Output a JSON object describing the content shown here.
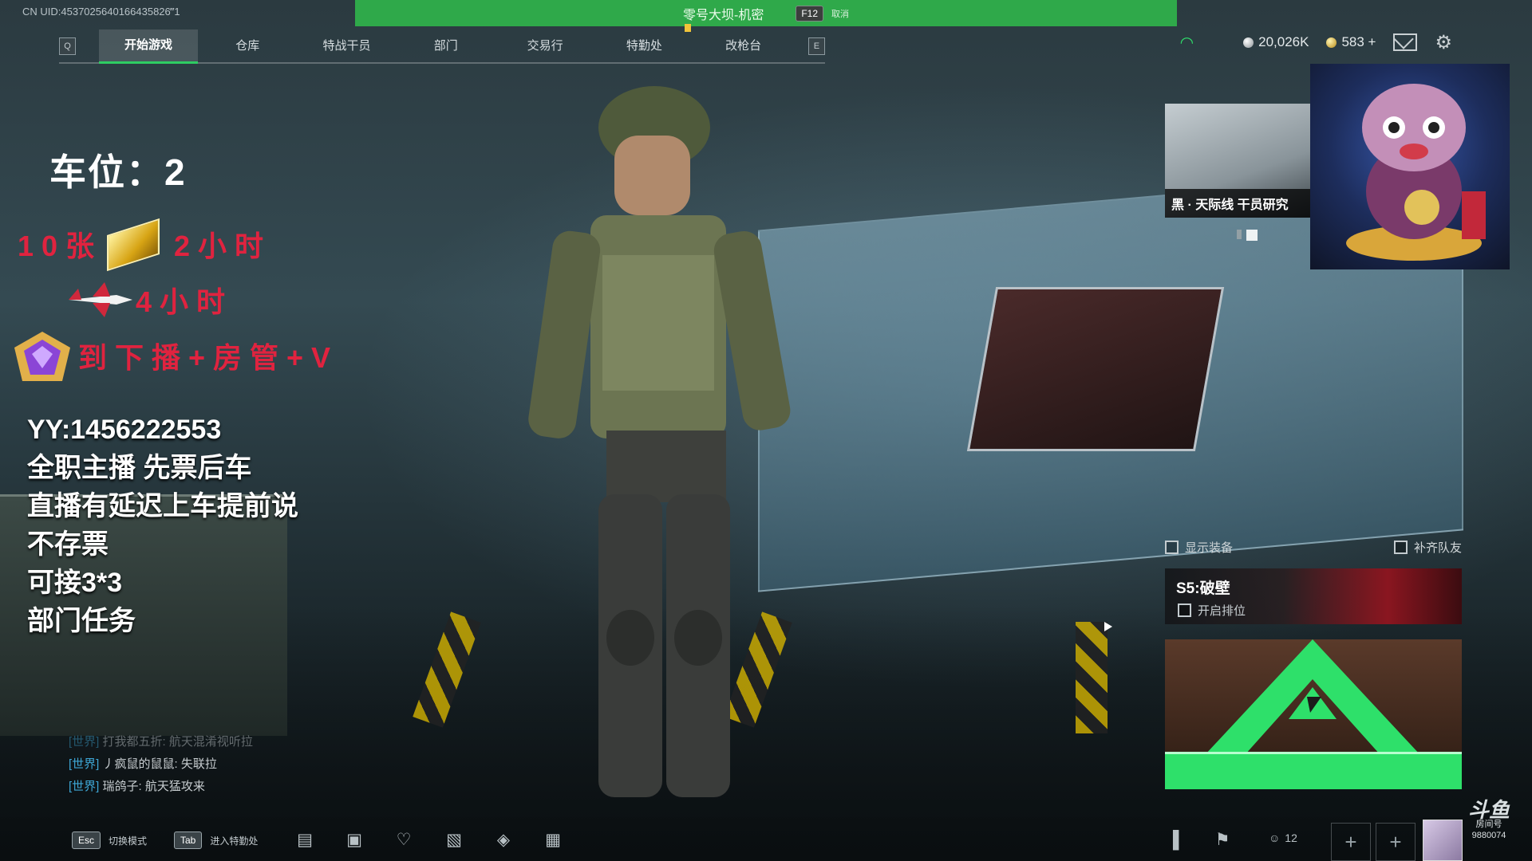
{
  "uid": "CN UID:4537025640166435826‴1",
  "banner": {
    "title": "零号大坝-机密",
    "key": "F12",
    "cancel": "取消"
  },
  "nav": {
    "left_key": "Q",
    "right_key": "E",
    "tabs": [
      "开始游戏",
      "仓库",
      "特战干员",
      "部门",
      "交易行",
      "特勤处",
      "改枪台"
    ],
    "active": "开始游戏"
  },
  "currency": {
    "silver": "20,026K",
    "gold": "583 +"
  },
  "overlay": {
    "slot": "车位：2",
    "promo1": "10张",
    "promo1b": "2小时",
    "promo2": "4小时",
    "promo3": "到下播+房管+V",
    "lines": [
      "YY:1456222553",
      "全职主播 先票后车",
      "直播有延迟上车提前说",
      "不存票",
      "可接3*3",
      "部门任务"
    ]
  },
  "chat": [
    {
      "channel": "[世界]",
      "text": "打我都五折: 航天混淆视听拉",
      "faded": true
    },
    {
      "channel": "[世界]",
      "text": "丿疯鼠的鼠鼠: 失联拉",
      "faded": false
    },
    {
      "channel": "[世界]",
      "text": "瑞鸽子: 航天猛攻来",
      "faded": false
    }
  ],
  "thumb_label": "黑 · 天际线 干员研究",
  "toggles": {
    "show_gear": "显示装备",
    "fill_team": "补齐队友"
  },
  "season": {
    "title": "S5:破壁",
    "ranked": "开启排位"
  },
  "bottom": {
    "esc_key": "Esc",
    "esc_label": "切换模式",
    "tab_key": "Tab",
    "tab_label": "进入特勤处",
    "team_count": "12",
    "douyu_logo": "斗鱼",
    "douyu_sub": "房间号",
    "room_id": "9880074"
  },
  "colors": {
    "accent": "#2ee06a",
    "banner": "#2fa94a",
    "promo": "#e0233f"
  }
}
